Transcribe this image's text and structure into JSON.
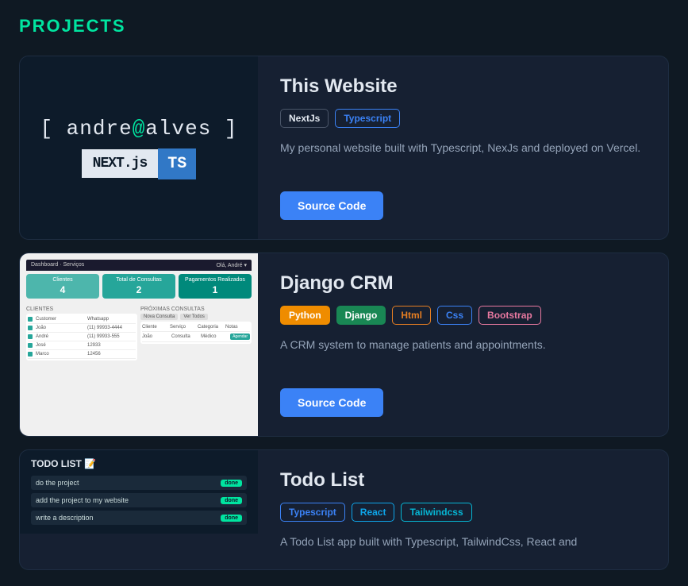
{
  "page": {
    "title": "PROJECTS"
  },
  "projects": [
    {
      "id": "this-website",
      "name": "This Website",
      "tags": [
        "NextJs",
        "Typescript"
      ],
      "tag_classes": [
        "tag-nextjs",
        "tag-typescript"
      ],
      "description": "My personal website built with Typescript, NexJs and deployed on Vercel.",
      "source_label": "Source Code",
      "thumbnail_type": "website"
    },
    {
      "id": "django-crm",
      "name": "Django CRM",
      "tags": [
        "Python",
        "Django",
        "Html",
        "Css",
        "Bootstrap"
      ],
      "tag_classes": [
        "tag-python",
        "tag-django",
        "tag-html",
        "tag-css",
        "tag-bootstrap"
      ],
      "description": "A CRM system to manage patients and appointments.",
      "source_label": "Source Code",
      "thumbnail_type": "django"
    },
    {
      "id": "todo-list",
      "name": "Todo List",
      "tags": [
        "Typescript",
        "React",
        "Tailwindcss"
      ],
      "tag_classes": [
        "tag-typescript2",
        "tag-react",
        "tag-tailwind"
      ],
      "description": "A Todo List app built with Typescript, TailwindCss, React and",
      "source_label": "Source Code",
      "thumbnail_type": "todo"
    }
  ],
  "icons": {
    "emoji_note": "📝"
  }
}
